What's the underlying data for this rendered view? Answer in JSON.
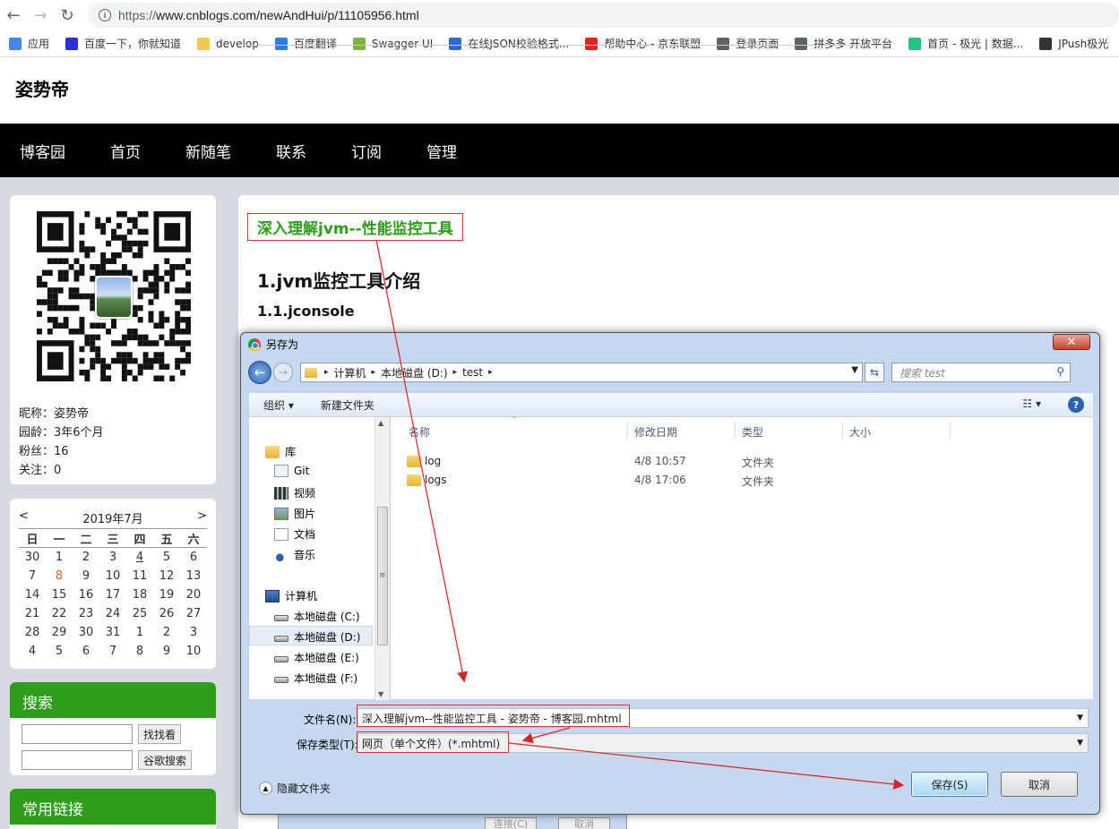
{
  "browser": {
    "url_scheme": "https://",
    "url_rest": "www.cnblogs.com/newAndHui/p/11105956.html",
    "bookmarks": [
      {
        "label": "应用",
        "color": "#4285f4"
      },
      {
        "label": "百度一下，你就知道",
        "color": "#2932e1"
      },
      {
        "label": "develop",
        "color": "#f2c94c"
      },
      {
        "label": "百度翻译",
        "color": "#2b7de9"
      },
      {
        "label": "Swagger UI",
        "color": "#7cb342"
      },
      {
        "label": "在线JSON校验格式...",
        "color": "#3367d6"
      },
      {
        "label": "帮助中心 - 京东联盟",
        "color": "#e1251b"
      },
      {
        "label": "登录页面",
        "color": "#5f6368"
      },
      {
        "label": "拼多多 开放平台",
        "color": "#5f6368"
      },
      {
        "label": "首页 - 极光 | 数据...",
        "color": "#26c281"
      },
      {
        "label": "JPush极光",
        "color": "#333333"
      }
    ]
  },
  "blog": {
    "title": "姿势帝",
    "nav": [
      "博客园",
      "首页",
      "新随笔",
      "联系",
      "订阅",
      "管理"
    ]
  },
  "sidebar": {
    "profile": {
      "nickname": "昵称：姿势帝",
      "age": "园龄：3年6个月",
      "fans": "粉丝：16",
      "follow": "关注：0"
    },
    "calendar": {
      "prev": "<",
      "month": "2019年7月",
      "next": ">",
      "weekdays": [
        "日",
        "一",
        "二",
        "三",
        "四",
        "五",
        "六"
      ],
      "weeks": [
        [
          "30",
          "1",
          "2",
          "3",
          "4",
          "5",
          "6"
        ],
        [
          "7",
          "8",
          "9",
          "10",
          "11",
          "12",
          "13"
        ],
        [
          "14",
          "15",
          "16",
          "17",
          "18",
          "19",
          "20"
        ],
        [
          "21",
          "22",
          "23",
          "24",
          "25",
          "26",
          "27"
        ],
        [
          "28",
          "29",
          "30",
          "31",
          "1",
          "2",
          "3"
        ],
        [
          "4",
          "5",
          "6",
          "7",
          "8",
          "9",
          "10"
        ]
      ]
    },
    "search": {
      "title": "搜索",
      "find_button": "找找看",
      "google_button": "谷歌搜索"
    },
    "links": {
      "title": "常用链接"
    }
  },
  "post": {
    "title": "深入理解jvm--性能监控工具",
    "h1": "1.jvm监控工具介绍",
    "h2": "1.1.jconsole"
  },
  "dialog": {
    "title": "另存为",
    "close": "✕",
    "path": [
      "计算机",
      "本地磁盘 (D:)",
      "test"
    ],
    "search_placeholder": "搜索 test",
    "organize": "组织 ▾",
    "new_folder": "新建文件夹",
    "help": "?",
    "tree": [
      {
        "label": "库",
        "icon": "library-icon"
      },
      {
        "label": "Git",
        "icon": "git-icon"
      },
      {
        "label": "视频",
        "icon": "video-icon"
      },
      {
        "label": "图片",
        "icon": "picture-icon"
      },
      {
        "label": "文档",
        "icon": "document-icon"
      },
      {
        "label": "音乐",
        "icon": "music-icon"
      },
      {
        "label": "计算机",
        "icon": "computer-icon"
      },
      {
        "label": "本地磁盘 (C:)",
        "icon": "drive-icon"
      },
      {
        "label": "本地磁盘 (D:)",
        "icon": "drive-icon"
      },
      {
        "label": "本地磁盘 (E:)",
        "icon": "drive-icon"
      },
      {
        "label": "本地磁盘 (F:)",
        "icon": "drive-icon"
      }
    ],
    "columns": [
      "名称",
      "修改日期",
      "类型",
      "大小"
    ],
    "files": [
      {
        "name": "log",
        "date": "4/8 10:57",
        "type": "文件夹"
      },
      {
        "name": "logs",
        "date": "4/8 17:06",
        "type": "文件夹"
      }
    ],
    "filename_label": "文件名(N):",
    "filename_value": "深入理解jvm--性能监控工具 - 姿势帝 - 博客园.mhtml",
    "filetype_label": "保存类型(T):",
    "filetype_value": "网页（单个文件）(*.mhtml)",
    "hide_folders": "隐藏文件夹",
    "save": "保存(S)",
    "cancel": "取消"
  },
  "behind_dialog": {
    "connect": "连接(C)",
    "cancel": "取消"
  },
  "colors": {
    "accent_green": "#2d9e1a",
    "annotation_red": "#dd2222"
  }
}
